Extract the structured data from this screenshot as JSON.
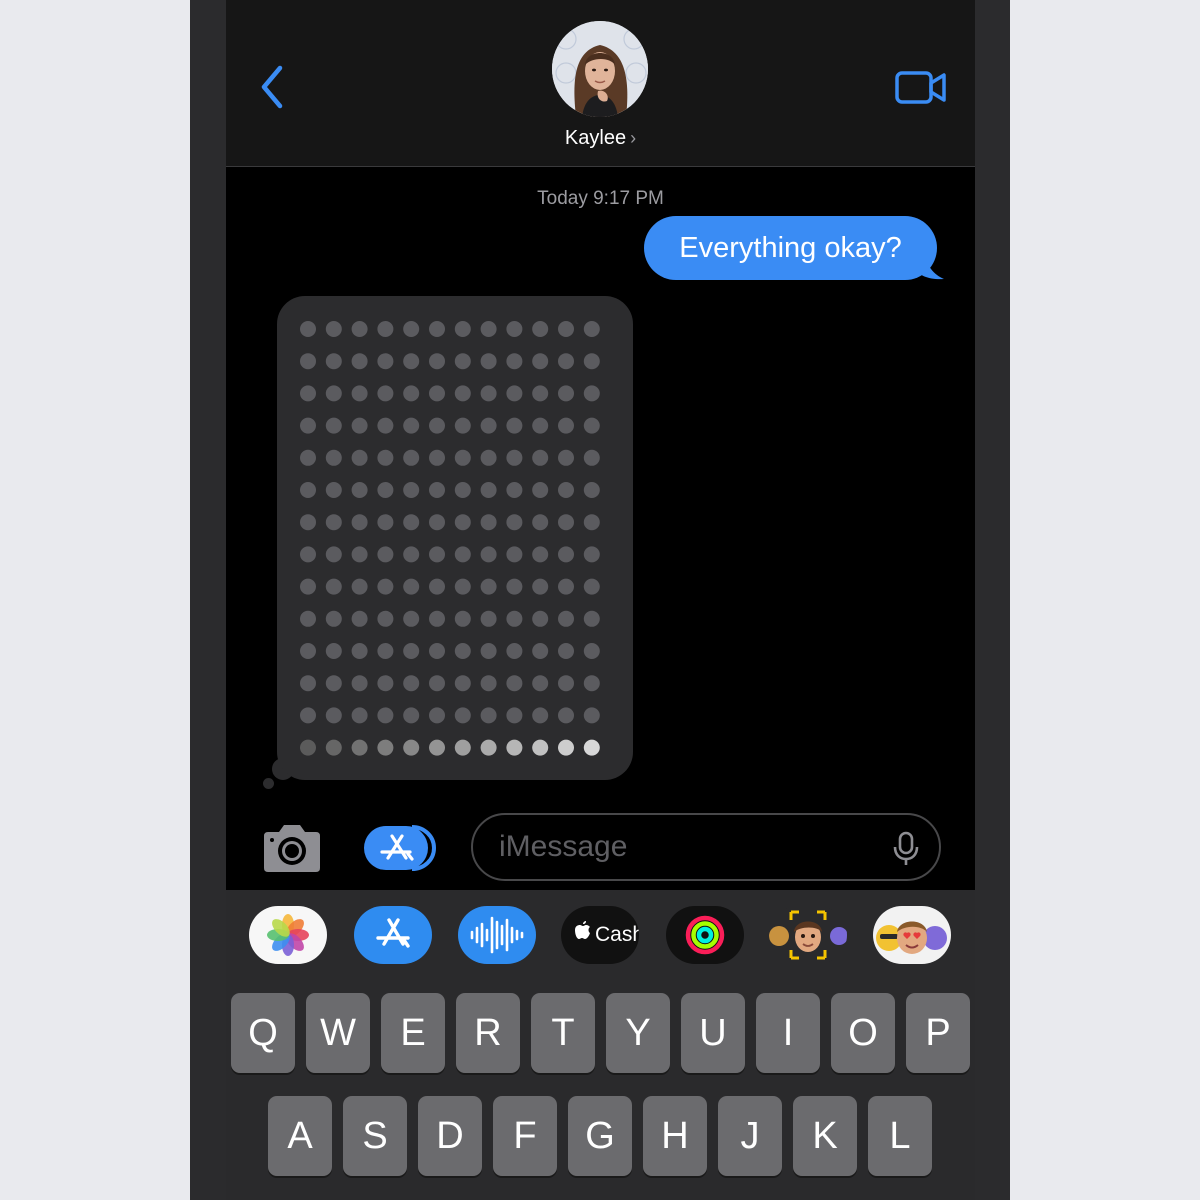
{
  "header": {
    "back_icon": "chevron-left-icon",
    "contact_name": "Kaylee",
    "chevron": "›",
    "video_icon": "video-camera-icon",
    "accent_color": "#3a8cf4"
  },
  "conversation": {
    "timestamp": "Today 9:17 PM",
    "outgoing_message": "Everything okay?",
    "incoming_typing_indicator": "digital-touch-doodle"
  },
  "input_bar": {
    "camera_icon": "camera-icon",
    "apps_icon": "app-store-icon",
    "placeholder": "iMessage",
    "mic_icon": "microphone-icon"
  },
  "app_strip": [
    {
      "name": "photos-app-icon"
    },
    {
      "name": "app-store-app-icon"
    },
    {
      "name": "audio-message-app-icon"
    },
    {
      "name": "apple-cash-app-icon",
      "label": "Cash"
    },
    {
      "name": "activity-app-icon"
    },
    {
      "name": "memoji-app-icon"
    },
    {
      "name": "memoji-stickers-app-icon"
    }
  ],
  "keyboard": {
    "row1": [
      "Q",
      "W",
      "E",
      "R",
      "T",
      "Y",
      "U",
      "I",
      "O",
      "P"
    ],
    "row2": [
      "A",
      "S",
      "D",
      "F",
      "G",
      "H",
      "J",
      "K",
      "L"
    ]
  }
}
